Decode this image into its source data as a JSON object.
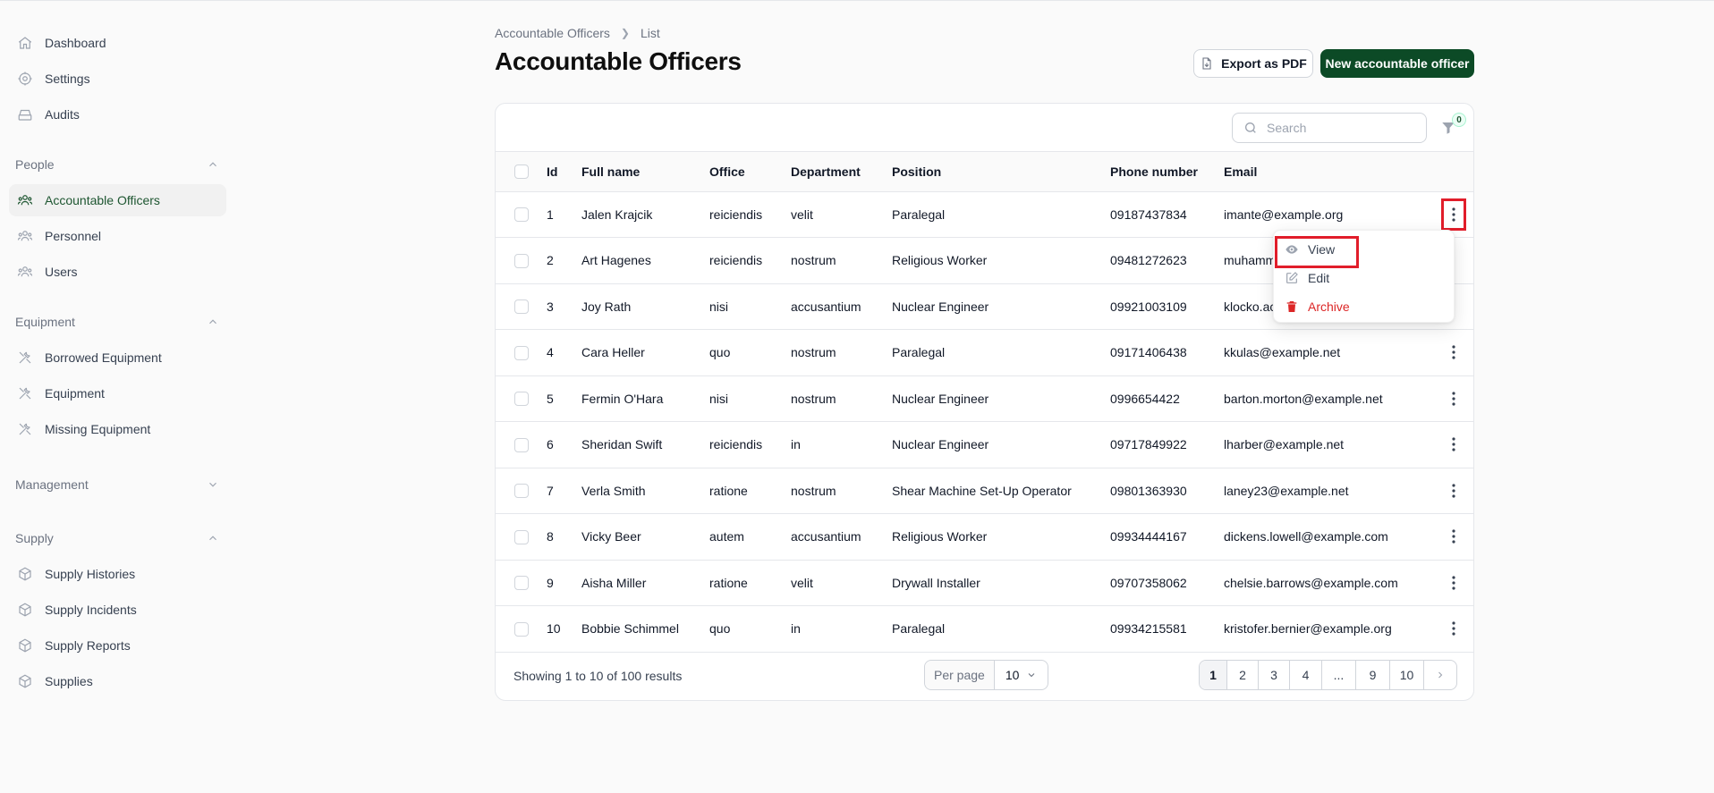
{
  "sidebar": {
    "top_items": [
      {
        "label": "Dashboard",
        "icon": "home-icon"
      },
      {
        "label": "Settings",
        "icon": "gear-icon"
      },
      {
        "label": "Audits",
        "icon": "inbox-icon"
      }
    ],
    "groups": [
      {
        "label": "People",
        "expanded": true,
        "items": [
          {
            "label": "Accountable Officers",
            "icon": "users-icon",
            "active": true
          },
          {
            "label": "Personnel",
            "icon": "users-icon"
          },
          {
            "label": "Users",
            "icon": "users-icon"
          }
        ]
      },
      {
        "label": "Equipment",
        "expanded": true,
        "items": [
          {
            "label": "Borrowed Equipment",
            "icon": "wrench-icon"
          },
          {
            "label": "Equipment",
            "icon": "wrench-icon"
          },
          {
            "label": "Missing Equipment",
            "icon": "wrench-icon"
          }
        ]
      },
      {
        "label": "Management",
        "expanded": false,
        "items": []
      },
      {
        "label": "Supply",
        "expanded": true,
        "items": [
          {
            "label": "Supply Histories",
            "icon": "cube-icon"
          },
          {
            "label": "Supply Incidents",
            "icon": "cube-icon"
          },
          {
            "label": "Supply Reports",
            "icon": "cube-icon"
          },
          {
            "label": "Supplies",
            "icon": "cube-icon"
          }
        ]
      }
    ]
  },
  "breadcrumb": {
    "parent": "Accountable Officers",
    "current": "List"
  },
  "page_title": "Accountable Officers",
  "actions": {
    "export_label": "Export as PDF",
    "new_label": "New accountable officer"
  },
  "search": {
    "placeholder": "Search",
    "value": ""
  },
  "filter": {
    "count": "0"
  },
  "table": {
    "columns": [
      "Id",
      "Full name",
      "Office",
      "Department",
      "Position",
      "Phone number",
      "Email"
    ],
    "rows": [
      {
        "id": "1",
        "name": "Jalen Krajcik",
        "office": "reiciendis",
        "dept": "velit",
        "position": "Paralegal",
        "phone": "09187437834",
        "email": "imante@example.org"
      },
      {
        "id": "2",
        "name": "Art Hagenes",
        "office": "reiciendis",
        "dept": "nostrum",
        "position": "Religious Worker",
        "phone": "09481272623",
        "email": "muhamm"
      },
      {
        "id": "3",
        "name": "Joy Rath",
        "office": "nisi",
        "dept": "accusantium",
        "position": "Nuclear Engineer",
        "phone": "09921003109",
        "email": "klocko.ac"
      },
      {
        "id": "4",
        "name": "Cara Heller",
        "office": "quo",
        "dept": "nostrum",
        "position": "Paralegal",
        "phone": "09171406438",
        "email": "kkulas@example.net"
      },
      {
        "id": "5",
        "name": "Fermin O'Hara",
        "office": "nisi",
        "dept": "nostrum",
        "position": "Nuclear Engineer",
        "phone": "0996654422",
        "email": "barton.morton@example.net"
      },
      {
        "id": "6",
        "name": "Sheridan Swift",
        "office": "reiciendis",
        "dept": "in",
        "position": "Nuclear Engineer",
        "phone": "09717849922",
        "email": "lharber@example.net"
      },
      {
        "id": "7",
        "name": "Verla Smith",
        "office": "ratione",
        "dept": "nostrum",
        "position": "Shear Machine Set-Up Operator",
        "phone": "09801363930",
        "email": "laney23@example.net"
      },
      {
        "id": "8",
        "name": "Vicky Beer",
        "office": "autem",
        "dept": "accusantium",
        "position": "Religious Worker",
        "phone": "09934444167",
        "email": "dickens.lowell@example.com"
      },
      {
        "id": "9",
        "name": "Aisha Miller",
        "office": "ratione",
        "dept": "velit",
        "position": "Drywall Installer",
        "phone": "09707358062",
        "email": "chelsie.barrows@example.com"
      },
      {
        "id": "10",
        "name": "Bobbie Schimmel",
        "office": "quo",
        "dept": "in",
        "position": "Paralegal",
        "phone": "09934215581",
        "email": "kristofer.bernier@example.org"
      }
    ]
  },
  "row_menu": {
    "view": "View",
    "edit": "Edit",
    "archive": "Archive"
  },
  "footer": {
    "results": "Showing 1 to 10 of 100 results",
    "per_page_label": "Per page",
    "per_page_value": "10",
    "pages": [
      "1",
      "2",
      "3",
      "4",
      "...",
      "9",
      "10"
    ],
    "current_page": "1"
  },
  "colors": {
    "brand": "#0c4a26",
    "danger": "#dc2626",
    "highlight": "#e11d2a"
  }
}
